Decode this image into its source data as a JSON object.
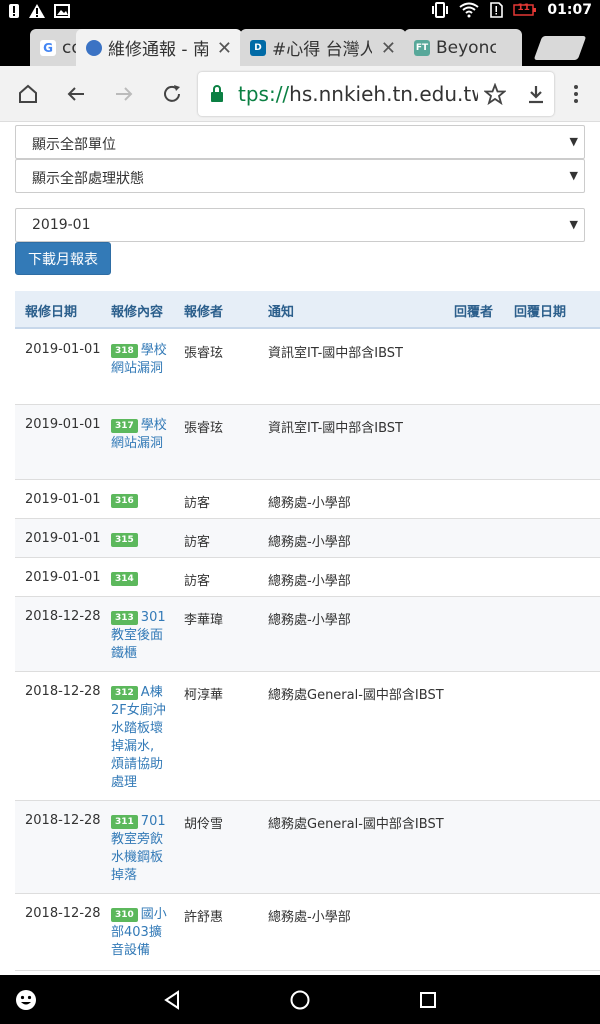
{
  "status_bar": {
    "time": "01:07",
    "battery": "11"
  },
  "tabs": [
    {
      "title": "co",
      "favicon": "google-icon",
      "active": false
    },
    {
      "title": "維修通報 - 南",
      "favicon": "globe-icon",
      "active": true
    },
    {
      "title": "#心得 台灣人",
      "favicon": "dcard-icon",
      "active": false
    },
    {
      "title": "Beyonc",
      "favicon": "ft-icon",
      "active": false
    }
  ],
  "address_bar": {
    "scheme": "tps://",
    "host": "hs.nnkieh.tn.edu.tw"
  },
  "filters": {
    "unit": "顯示全部單位",
    "status": "顯示全部處理狀態",
    "month": "2019-01"
  },
  "download_button": "下載月報表",
  "table": {
    "headers": [
      "報修日期",
      "報修內容",
      "報修者",
      "通知",
      "回覆者",
      "回覆日期"
    ],
    "rows": [
      {
        "date": "2019-01-01",
        "badge": "318",
        "text": "學校網站漏洞",
        "reporter": "張睿玹",
        "notify": "資訊室IT-國中部含IBST"
      },
      {
        "date": "2019-01-01",
        "badge": "317",
        "text": "學校網站漏洞",
        "reporter": "張睿玹",
        "notify": "資訊室IT-國中部含IBST"
      },
      {
        "date": "2019-01-01",
        "badge": "316",
        "text": "",
        "reporter": "訪客",
        "notify": "總務處-小學部"
      },
      {
        "date": "2019-01-01",
        "badge": "315",
        "text": "",
        "reporter": "訪客",
        "notify": "總務處-小學部"
      },
      {
        "date": "2019-01-01",
        "badge": "314",
        "text": "",
        "reporter": "訪客",
        "notify": "總務處-小學部"
      },
      {
        "date": "2018-12-28",
        "badge": "313",
        "text": "301教室後面鐵櫃",
        "reporter": "李華瑋",
        "notify": "總務處-小學部"
      },
      {
        "date": "2018-12-28",
        "badge": "312",
        "text": "A棟2F女廁沖水踏板壞掉漏水, 煩請協助處理",
        "reporter": "柯淳華",
        "notify": "總務處General-國中部含IBST"
      },
      {
        "date": "2018-12-28",
        "badge": "311",
        "text": "701教室旁飲水機鋼板掉落",
        "reporter": "胡伶雪",
        "notify": "總務處General-國中部含IBST"
      },
      {
        "date": "2018-12-28",
        "badge": "310",
        "text": "國小部403擴音設備",
        "reporter": "許舒惠",
        "notify": "總務處-小學部"
      }
    ]
  }
}
